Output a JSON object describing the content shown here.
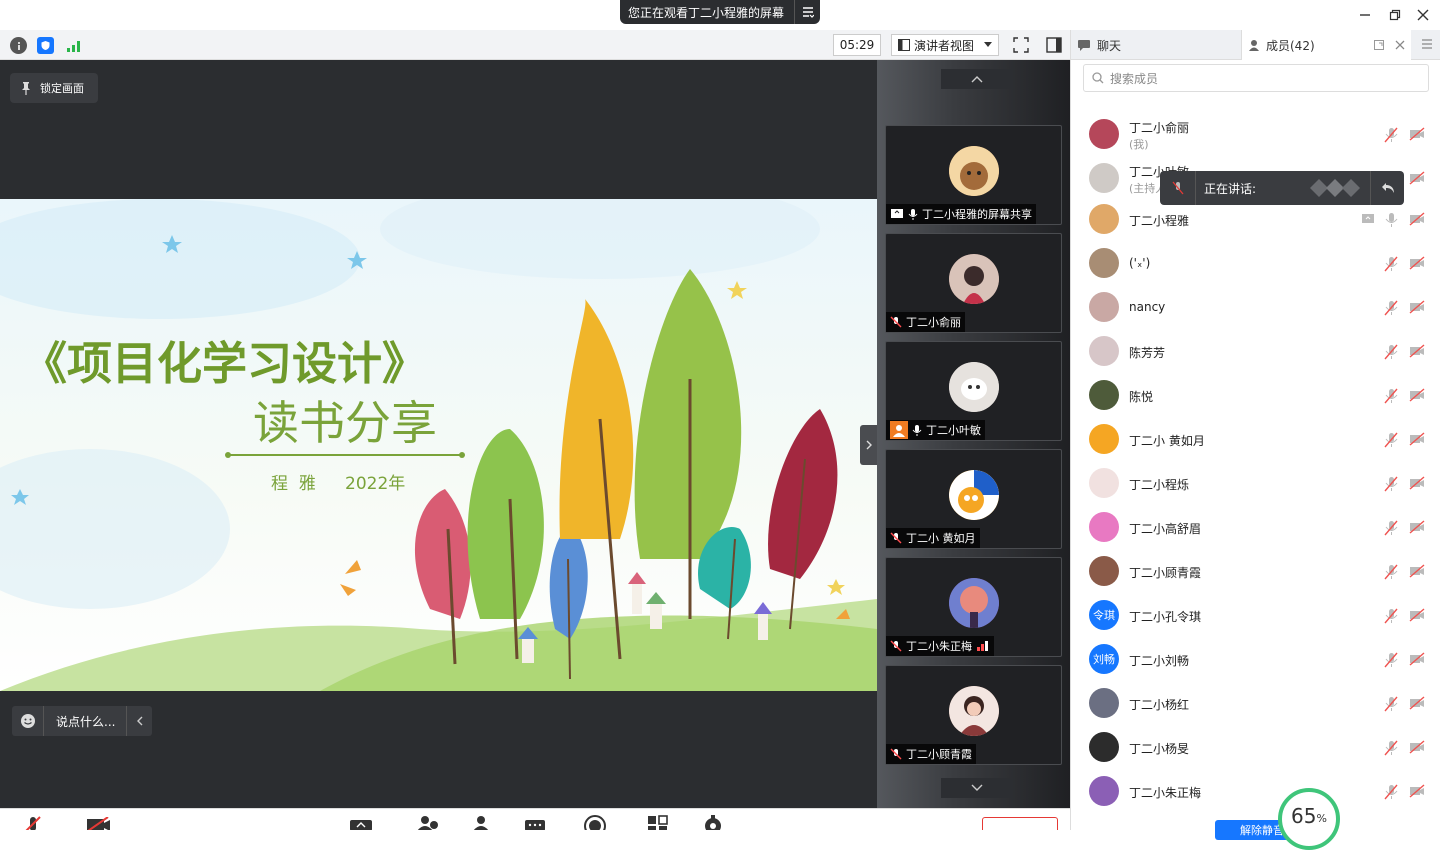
{
  "titlebar": {
    "share_banner": "您正在观看丁二小程雅的屏幕"
  },
  "toolbar": {
    "timer": "05:29",
    "view_mode": "演讲者视图"
  },
  "stage": {
    "lock_label": "锁定画面",
    "chat_placeholder": "说点什么...",
    "slide": {
      "title": "《项目化学习设计》",
      "subtitle": "读书分享",
      "author": "程  雅",
      "year": "2022年"
    }
  },
  "thumbnails": [
    {
      "name": "丁二小程雅的屏幕共享",
      "muted": false,
      "avatar_color": "#e9b77a"
    },
    {
      "name": "丁二小俞丽",
      "muted": true,
      "avatar_color": "#b88e84"
    },
    {
      "name": "丁二小叶敏",
      "muted": false,
      "avatar_color": "#d9d4d0"
    },
    {
      "name": "丁二小 黄如月",
      "muted": true,
      "avatar_color": "#f5a623"
    },
    {
      "name": "丁二小朱正梅",
      "muted": true,
      "avatar_color": "#8b5fb5"
    },
    {
      "name": "丁二小顾青霞",
      "muted": true,
      "avatar_color": "#c99b8a"
    }
  ],
  "panel": {
    "tab_chat": "聊天",
    "tab_members": "成员(42)",
    "search_placeholder": "搜索成员",
    "speaking_label": "正在讲话:",
    "unmute_all": "解除静音",
    "progress": "65",
    "progress_unit": "%",
    "members": [
      {
        "name": "丁二小俞丽",
        "sub": "(我)",
        "avatar_color": "#b5475a",
        "avatar_text": ""
      },
      {
        "name": "丁二小叶敏",
        "sub": "(主持人)",
        "avatar_color": "#cfcac6",
        "avatar_text": ""
      },
      {
        "name": "丁二小程雅",
        "sub": "",
        "avatar_color": "#e0a868",
        "avatar_text": ""
      },
      {
        "name": "('ₓ')",
        "sub": "",
        "avatar_color": "#a88d74",
        "avatar_text": ""
      },
      {
        "name": "nancy",
        "sub": "",
        "avatar_color": "#c9a8a4",
        "avatar_text": ""
      },
      {
        "name": "陈芳芳",
        "sub": "",
        "avatar_color": "#d7c6c8",
        "avatar_text": ""
      },
      {
        "name": "陈悦",
        "sub": "",
        "avatar_color": "#4e5b3a",
        "avatar_text": ""
      },
      {
        "name": "丁二小 黄如月",
        "sub": "",
        "avatar_color": "#f5a623",
        "avatar_text": ""
      },
      {
        "name": "丁二小程烁",
        "sub": "",
        "avatar_color": "#f1e1e0",
        "avatar_text": ""
      },
      {
        "name": "丁二小高舒眉",
        "sub": "",
        "avatar_color": "#e879c2",
        "avatar_text": ""
      },
      {
        "name": "丁二小顾青霞",
        "sub": "",
        "avatar_color": "#8a5a48",
        "avatar_text": ""
      },
      {
        "name": "丁二小孔令琪",
        "sub": "",
        "avatar_color": "#1677ff",
        "avatar_text": "令琪"
      },
      {
        "name": "丁二小刘畅",
        "sub": "",
        "avatar_color": "#1677ff",
        "avatar_text": "刘畅"
      },
      {
        "name": "丁二小杨红",
        "sub": "",
        "avatar_color": "#6b6f82",
        "avatar_text": ""
      },
      {
        "name": "丁二小杨旻",
        "sub": "",
        "avatar_color": "#2c2c2c",
        "avatar_text": ""
      },
      {
        "name": "丁二小朱正梅",
        "sub": "",
        "avatar_color": "#8b5fb5",
        "avatar_text": ""
      }
    ]
  }
}
